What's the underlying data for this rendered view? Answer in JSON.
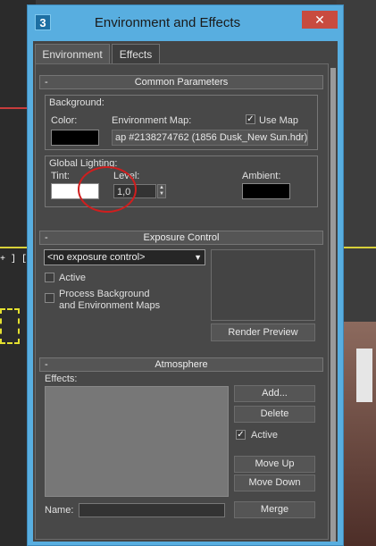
{
  "window": {
    "title": "Environment and Effects",
    "close_glyph": "✕",
    "app_icon_glyph": "3"
  },
  "tabs": [
    {
      "label": "Environment",
      "active": true
    },
    {
      "label": "Effects",
      "active": false
    }
  ],
  "common_parameters": {
    "header": "Common Parameters",
    "collapse_glyph": "-",
    "background": {
      "group_label": "Background:",
      "color_label": "Color:",
      "color_value": "#000000",
      "env_map_label": "Environment Map:",
      "use_map_label": "Use Map",
      "use_map_checked": true,
      "env_map_value": "ap #2138274762 (1856 Dusk_New Sun.hdr)"
    },
    "global_lighting": {
      "group_label": "Global Lighting:",
      "tint_label": "Tint:",
      "tint_value": "#ffffff",
      "level_label": "Level:",
      "level_value": "1,0",
      "ambient_label": "Ambient:",
      "ambient_value": "#000000"
    }
  },
  "exposure_control": {
    "header": "Exposure Control",
    "collapse_glyph": "-",
    "dropdown_value": "<no exposure control>",
    "active_label": "Active",
    "process_line1": "Process Background",
    "process_line2": "and Environment Maps",
    "render_preview_label": "Render Preview"
  },
  "atmosphere": {
    "header": "Atmosphere",
    "collapse_glyph": "-",
    "effects_label": "Effects:",
    "add_label": "Add...",
    "delete_label": "Delete",
    "active_label": "Active",
    "active_checked": true,
    "move_up_label": "Move Up",
    "move_down_label": "Move Down",
    "name_label": "Name:",
    "merge_label": "Merge"
  },
  "viewport": {
    "label": "+ ] [VF"
  },
  "colors": {
    "title_bar": "#58aee0",
    "close_button": "#c84b3f",
    "panel_bg": "#484848",
    "annotation_circle": "#d01e1e"
  }
}
